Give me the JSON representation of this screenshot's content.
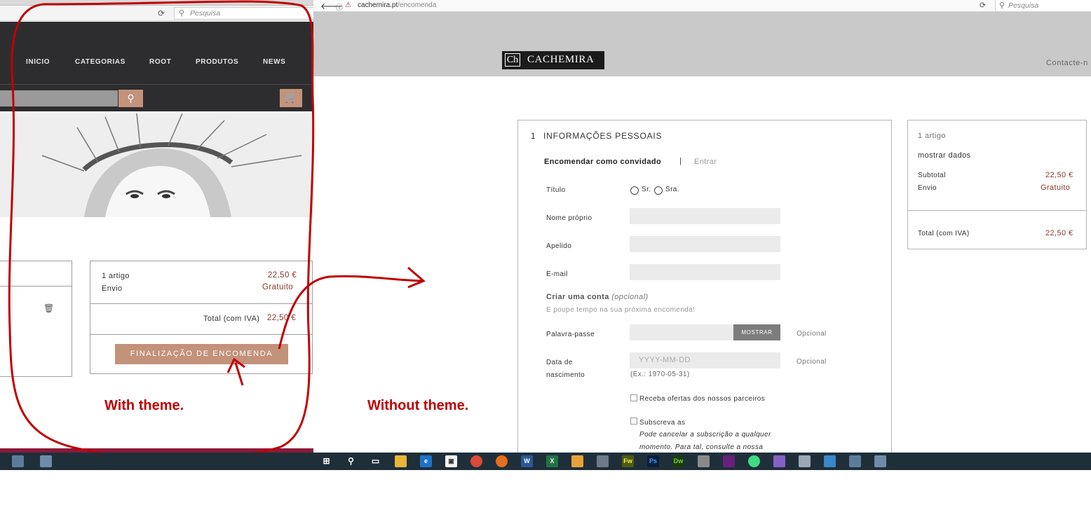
{
  "left": {
    "search_placeholder": "Pesquisa",
    "nav": [
      "INICIO",
      "CATEGORIAS",
      "ROOT",
      "PRODUTOS",
      "NEWS"
    ],
    "summary": {
      "items_label": "1 artigo",
      "items_price": "22,50 €",
      "shipping_label": "Envio",
      "shipping_value": "Gratuito",
      "total_label": "Total (com IVA)",
      "total_value": "22,50 €",
      "checkout_label": "FINALIZAÇÃO DE ENCOMENDA"
    }
  },
  "annotations": {
    "with_theme": "With theme.",
    "without_theme": "Without theme."
  },
  "right": {
    "url_host": "cachemira.pt",
    "url_path": "/encomenda",
    "search_placeholder": "Pesquisa",
    "logo_mark": "Ch",
    "logo_text": "CACHEMIRA",
    "contact": "Contacte-n",
    "form": {
      "step_number": "1",
      "step_title": "INFORMAÇÕES PESSOAIS",
      "tab_guest": "Encomendar como convidado",
      "tab_separator": "|",
      "tab_login": "Entrar",
      "title_label": "Título",
      "title_options": [
        "Sr.",
        "Sra."
      ],
      "first_name_label": "Nome próprio",
      "last_name_label": "Apelido",
      "email_label": "E-mail",
      "create_account": "Criar uma conta",
      "create_account_optional": "(opcional)",
      "save_time_hint": "E poupe tempo na sua próxima encomenda!",
      "password_label": "Palavra-passe",
      "show_button": "MOSTRAR",
      "password_optional": "Opcional",
      "birthdate_label_line1": "Data de",
      "birthdate_label_line2": "nascimento",
      "birthdate_placeholder": "YYYY-MM-DD",
      "birthdate_optional": "Opcional",
      "birthdate_example": "(Ex.: 1970-05-31)",
      "offers_label": "Receba ofertas dos nossos parceiros",
      "subscribe_label": "Subscreva as",
      "subscribe_note_line1": "Pode cancelar a subscrição a qualquer",
      "subscribe_note_line2": "momento. Para tal, consulte a nossa"
    },
    "summary": {
      "items": "1 artigo",
      "show_details": "mostrar dados",
      "subtotal_label": "Subtotal",
      "subtotal_value": "22,50 €",
      "shipping_label": "Envio",
      "shipping_value": "Gratuito",
      "total_label": "Total (com IVA)",
      "total_value": "22,50 €"
    }
  },
  "taskbar": {
    "icons": [
      "windows-start",
      "search",
      "task-view",
      "file-explorer",
      "edge",
      "store",
      "chrome",
      "firefox",
      "word",
      "excel",
      "outlook",
      "photos",
      "fireworks",
      "photoshop",
      "dreamweaver",
      "tools",
      "visual-studio",
      "android-studio",
      "visual-studio-2",
      "search-tool",
      "mail",
      "app",
      "window"
    ]
  }
}
